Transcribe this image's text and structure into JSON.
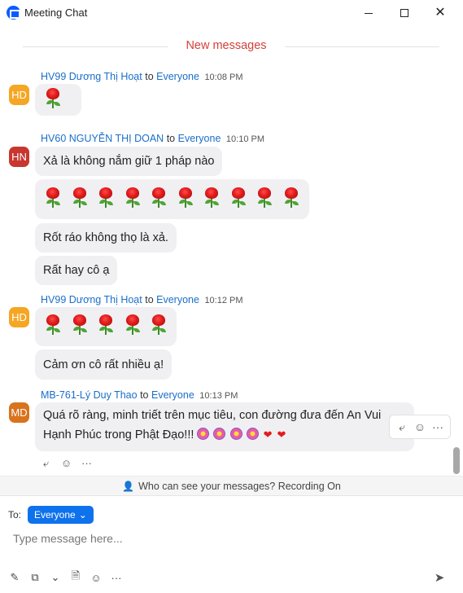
{
  "window": {
    "title": "Meeting Chat",
    "minimize_glyph": "—",
    "close_glyph": "✕"
  },
  "chat": {
    "new_messages_label": "New messages",
    "to_word": "to",
    "messages": [
      {
        "avatar": "HD",
        "sender": "HV99 Dương Thị Hoạt",
        "recipient": "Everyone",
        "time": "10:08 PM"
      },
      {
        "avatar": "HN",
        "sender": "HV60 NGUYỄN THỊ DOAN",
        "recipient": "Everyone",
        "time": "10:10 PM",
        "lines": [
          "Xả là không nắm giữ 1 pháp nào",
          "Rốt ráo không thọ là xả.",
          "Rất hay cô ạ"
        ]
      },
      {
        "avatar": "HD",
        "sender": "HV99 Dương Thị Hoạt",
        "recipient": "Everyone",
        "time": "10:12 PM",
        "lines": [
          "Cảm ơn cô rất nhiều ạ!"
        ]
      },
      {
        "avatar": "MD",
        "sender": "MB-761-Lý Duy Thao",
        "recipient": "Everyone",
        "time": "10:13 PM",
        "text_line1": "Quá rõ ràng, minh triết trên mục tiêu, con đường đưa đến An Vui",
        "text_line2": "Hạnh Phúc trong Phật Đạo!!!"
      }
    ],
    "rose_counts": [
      1,
      10,
      5
    ],
    "icons": {
      "reply": "reply-icon",
      "react": "add-reaction-icon",
      "more": "more-icon",
      "heart": "❤"
    },
    "glyphs": {
      "more": "···",
      "reply": "⤶",
      "react": "☺",
      "heart": "❤"
    }
  },
  "notice": {
    "text": "Who can see your messages? Recording On",
    "icon_glyph": "👤"
  },
  "compose": {
    "to_label": "To:",
    "recipient": "Everyone",
    "chevron": "⌄",
    "placeholder": "Type message here...",
    "toolbar_glyphs": [
      "✎",
      "⧉",
      "⌄",
      "🗎",
      "☺",
      "···"
    ],
    "send_glyph": "➤"
  },
  "colors": {
    "accent_blue": "#0e72ed",
    "name_blue": "#1a6fc9",
    "new_messages_red": "#d4403a",
    "bubble_bg": "#f0f0f3"
  }
}
